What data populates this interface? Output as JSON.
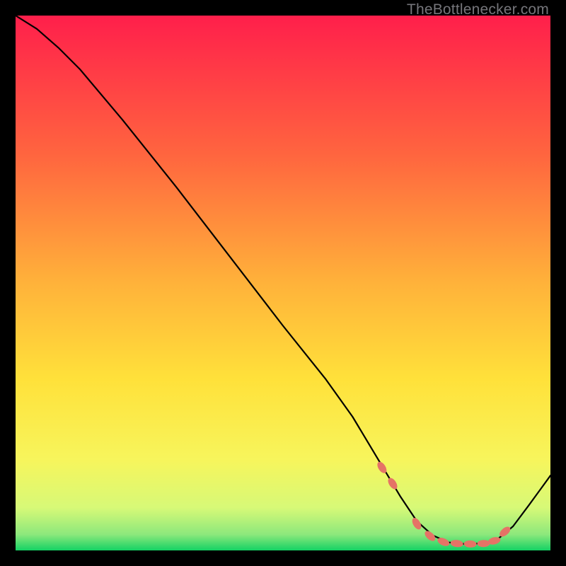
{
  "watermark": "TheBottlenecker.com",
  "colors": {
    "bg": "#000000",
    "curve": "#000000",
    "marker_fill": "#e57366",
    "marker_stroke": "#cf5c52",
    "grad_top": "#ff1f4b",
    "grad_mid1": "#ff7a3c",
    "grad_mid2": "#ffd33a",
    "grad_mid3": "#f7f55c",
    "grad_mid4": "#e3f976",
    "grad_bottom": "#14d264"
  },
  "chart_data": {
    "type": "line",
    "title": "",
    "xlabel": "",
    "ylabel": "",
    "xlim": [
      0,
      100
    ],
    "ylim": [
      0,
      100
    ],
    "series": [
      {
        "name": "curve",
        "x": [
          0,
          4,
          8,
          12,
          20,
          30,
          40,
          50,
          58,
          63,
          66,
          69,
          72,
          75,
          78,
          81,
          84,
          87,
          90,
          93,
          96,
          100
        ],
        "y": [
          100,
          97.5,
          94,
          90,
          80.5,
          68,
          55,
          42,
          32,
          25,
          20,
          15,
          10,
          5.5,
          2.8,
          1.5,
          1.2,
          1.3,
          2.0,
          4.5,
          8.5,
          14
        ]
      }
    ],
    "markers": {
      "name": "highlight-dots",
      "x": [
        68.5,
        70.5,
        75,
        77.5,
        80,
        82.5,
        85,
        87.5,
        89.5,
        91.5
      ],
      "y": [
        15.5,
        12.5,
        5.0,
        2.7,
        1.6,
        1.3,
        1.2,
        1.3,
        1.8,
        3.5
      ]
    }
  }
}
